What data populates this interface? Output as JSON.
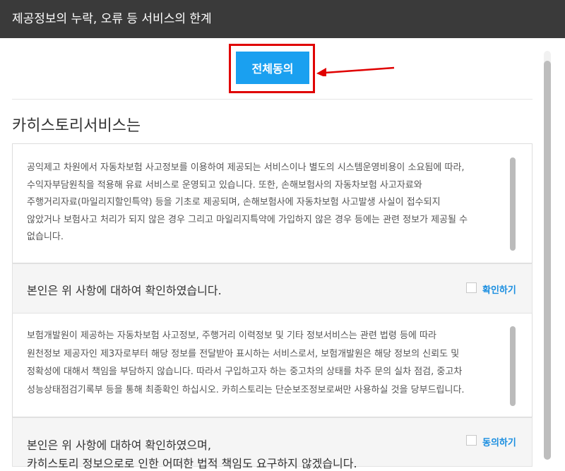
{
  "header": {
    "title": "제공정보의 누락, 오류 등 서비스의 한계"
  },
  "agree_all": {
    "label": "전체동의"
  },
  "section": {
    "title": "카히스토리서비스는"
  },
  "notice1": {
    "lines": [
      "공익제고 차원에서 자동차보험 사고정보를 이용하여 제공되는 서비스이나 별도의 시스템운영비용이 소요됨에 따라,",
      "수익자부담원칙을 적용해 유료 서비스로 운영되고 있습니다. 또한, 손해보험사의 자동차보험 사고자료와",
      "주행거리자료(마일리지할인특약) 등을 기초로 제공되며, 손해보험사에 자동차보험 사고발생 사실이 접수되지",
      "않았거나 보험사고 처리가 되지 않은 경우 그리고 마일리지특약에 가입하지 않은 경우 등에는 관련 정보가 제공될 수",
      "없습니다."
    ]
  },
  "confirm1": {
    "label": "본인은 위 사항에 대하여 확인하였습니다.",
    "checkbox_label": "확인하기"
  },
  "notice2": {
    "lines": [
      "보험개발원이 제공하는 자동차보험 사고정보, 주행거리 이력정보 및 기타 정보서비스는 관련 법령 등에 따라",
      "원천정보 제공자인 제3자로부터 해당 정보를 전달받아 표시하는 서비스로서, 보험개발원은 해당 정보의 신뢰도 및",
      "정확성에 대해서 책임을 부담하지 않습니다. 따라서 구입하고자 하는 중고차의 상태를 차주 문의 실차 점검, 중고차",
      "성능상태점검기록부 등을 통해 최종확인 하십시오. 카히스토리는 단순보조정보로써만 사용하실 것을 당부드립니다."
    ]
  },
  "confirm2": {
    "line1": "본인은 위 사항에 대하여 확인하였으며,",
    "line2": "카히스토리 정보으로로 인한 어떠한 법적 책임도 요구하지 않겠습니다.",
    "checkbox_label": "동의하기"
  },
  "colors": {
    "accent": "#1aa0f0",
    "highlight": "#e00000",
    "header_bg": "#3a3a3a"
  }
}
